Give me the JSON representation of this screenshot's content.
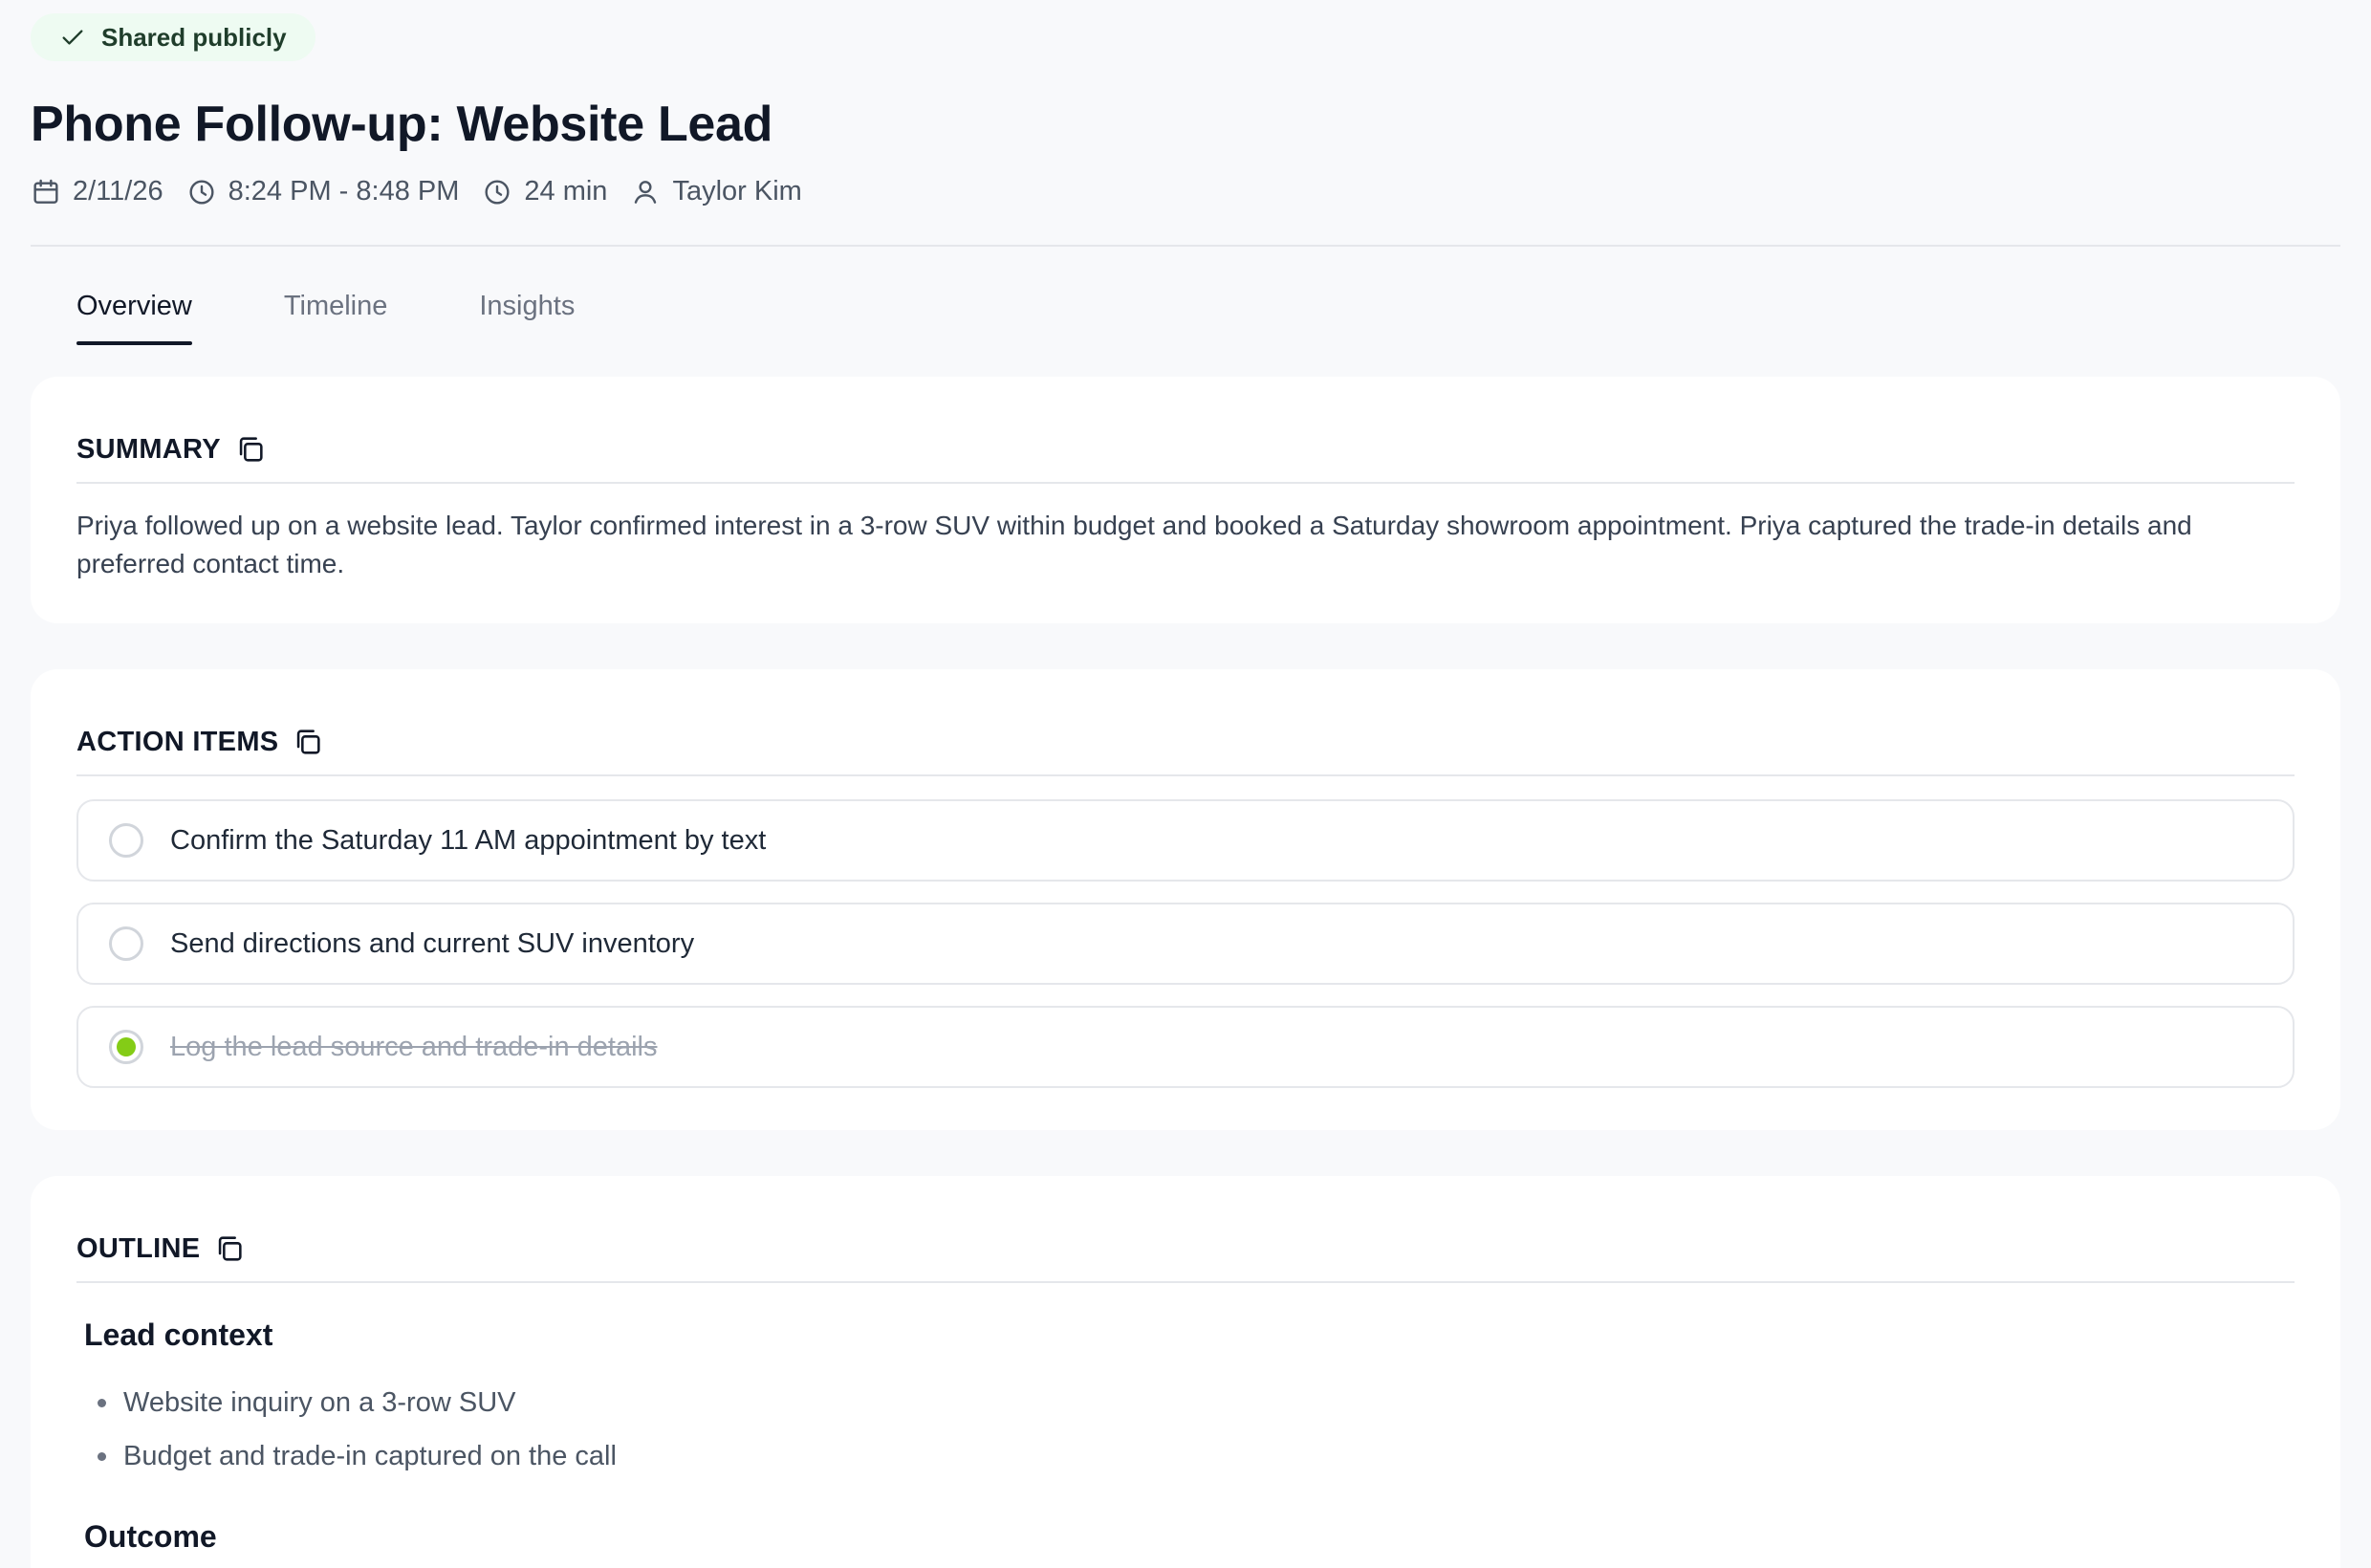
{
  "share": {
    "label": "Shared publicly"
  },
  "page": {
    "title": "Phone Follow-up: Website Lead",
    "meta": {
      "date": "2/11/26",
      "time_range": "8:24 PM - 8:48 PM",
      "duration": "24 min",
      "contact": "Taylor Kim"
    }
  },
  "tabs": [
    {
      "label": "Overview",
      "active": true
    },
    {
      "label": "Timeline",
      "active": false
    },
    {
      "label": "Insights",
      "active": false
    }
  ],
  "summary": {
    "heading": "SUMMARY",
    "text": "Priya followed up on a website lead. Taylor confirmed interest in a 3-row SUV within budget and booked a Saturday showroom appointment. Priya captured the trade-in details and preferred contact time."
  },
  "action_items": {
    "heading": "ACTION ITEMS",
    "items": [
      {
        "text": "Confirm the Saturday 11 AM appointment by text",
        "done": false
      },
      {
        "text": "Send directions and current SUV inventory",
        "done": false
      },
      {
        "text": "Log the lead source and trade-in details",
        "done": true
      }
    ]
  },
  "outline": {
    "heading": "OUTLINE",
    "sections": [
      {
        "title": "Lead context",
        "bullets": [
          "Website inquiry on a 3-row SUV",
          "Budget and trade-in captured on the call"
        ]
      },
      {
        "title": "Outcome",
        "bullets": []
      }
    ]
  },
  "colors": {
    "badge_bg": "#eefbf2",
    "done_dot": "#84cc16",
    "border": "#e5e7eb"
  },
  "icons": {
    "badge": "check-icon",
    "date": "calendar-icon",
    "time": "clock-icon",
    "duration": "clock-icon",
    "contact": "user-icon",
    "copy": "copy-icon"
  }
}
